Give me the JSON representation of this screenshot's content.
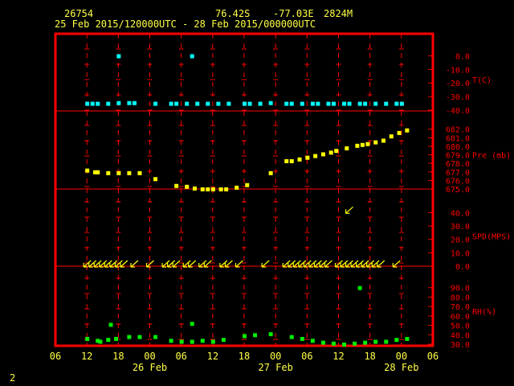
{
  "header": {
    "station_id": "26754",
    "lat": "76.42S",
    "lon": "-77.03E",
    "elevation": "2824M",
    "time_range": "25 Feb 2015/120000UTC - 28 Feb 2015/000000UTC"
  },
  "page_number": "2",
  "colors": {
    "frame": "#ff0000",
    "text": "#ffff44",
    "temperature": "#00ffff",
    "pressure": "#ffff00",
    "wind": "#ffff00",
    "rh": "#00ee00"
  },
  "chart_data": {
    "type": "scatter",
    "x_axis": {
      "unit": "hours since 26 Feb 00 UTC",
      "range": [
        -18,
        54
      ],
      "tick_values": [
        -18,
        -12,
        -6,
        0,
        6,
        12,
        18,
        24,
        30,
        36,
        42,
        48,
        54
      ],
      "tick_labels": [
        "06",
        "12",
        "18",
        "00",
        "06",
        "12",
        "18",
        "00",
        "06",
        "12",
        "18",
        "00",
        "06"
      ],
      "date_labels": [
        {
          "x": 0,
          "label": "26 Feb"
        },
        {
          "x": 24,
          "label": "27 Feb"
        },
        {
          "x": 48,
          "label": "28 Feb"
        }
      ]
    },
    "panels": [
      {
        "name": "temperature",
        "label": "T(C)",
        "ylim": [
          -40,
          5
        ],
        "tick_values": [
          0,
          -10,
          -20,
          -30,
          -40
        ],
        "tick_labels": [
          "0.0",
          "-10.0",
          "-20.0",
          "-30.0",
          "-40.0"
        ],
        "points": [
          [
            -12,
            -35
          ],
          [
            -11,
            -35
          ],
          [
            -10,
            -35
          ],
          [
            -8,
            -35
          ],
          [
            -6,
            -34.5
          ],
          [
            -4,
            -34.5
          ],
          [
            -3,
            -34.5
          ],
          [
            1,
            -35
          ],
          [
            4,
            -35
          ],
          [
            5,
            -35
          ],
          [
            7,
            -35
          ],
          [
            9,
            -35
          ],
          [
            11,
            -35
          ],
          [
            13,
            -35
          ],
          [
            15,
            -35
          ],
          [
            18,
            -35
          ],
          [
            19,
            -35
          ],
          [
            21,
            -35
          ],
          [
            23,
            -34.5
          ],
          [
            26,
            -35
          ],
          [
            27,
            -35
          ],
          [
            29,
            -35
          ],
          [
            31,
            -35
          ],
          [
            32,
            -35
          ],
          [
            34,
            -35
          ],
          [
            35,
            -35
          ],
          [
            37,
            -35
          ],
          [
            38,
            -35
          ],
          [
            40,
            -35
          ],
          [
            41,
            -35
          ],
          [
            43,
            -35
          ],
          [
            45,
            -35
          ],
          [
            47,
            -35
          ],
          [
            48,
            -35
          ],
          [
            -6,
            0
          ],
          [
            8,
            0
          ]
        ]
      },
      {
        "name": "pressure",
        "label": "Pre (mb)",
        "ylim": [
          675,
          683
        ],
        "tick_values": [
          682,
          681,
          680,
          679,
          678,
          677,
          676,
          675
        ],
        "tick_labels": [
          "682.0",
          "681.0",
          "680.0",
          "679.0",
          "678.0",
          "677.0",
          "676.0",
          "675.0"
        ],
        "points": [
          [
            -12,
            677.2
          ],
          [
            -10.5,
            677
          ],
          [
            -10,
            677
          ],
          [
            -8,
            676.9
          ],
          [
            -6,
            676.9
          ],
          [
            -4,
            676.9
          ],
          [
            -2,
            676.9
          ],
          [
            1,
            676.2
          ],
          [
            5,
            675.4
          ],
          [
            7,
            675.3
          ],
          [
            8.5,
            675.1
          ],
          [
            10,
            675
          ],
          [
            11,
            675
          ],
          [
            12,
            675
          ],
          [
            13.5,
            675
          ],
          [
            14.5,
            675
          ],
          [
            16.5,
            675.2
          ],
          [
            18.5,
            675.5
          ],
          [
            23,
            676.9
          ],
          [
            26,
            678.3
          ],
          [
            27,
            678.3
          ],
          [
            28.5,
            678.5
          ],
          [
            30,
            678.7
          ],
          [
            31.5,
            678.9
          ],
          [
            33,
            679.1
          ],
          [
            34.5,
            679.3
          ],
          [
            35.5,
            679.5
          ],
          [
            37.5,
            679.8
          ],
          [
            39.5,
            680.1
          ],
          [
            40.5,
            680.2
          ],
          [
            41.5,
            680.3
          ],
          [
            43,
            680.5
          ],
          [
            44.5,
            680.7
          ],
          [
            46,
            681.2
          ],
          [
            47.5,
            681.6
          ],
          [
            49,
            681.9
          ]
        ]
      },
      {
        "name": "wind",
        "label": "SPD(MPS)",
        "ylim": [
          0,
          45
        ],
        "tick_values": [
          40,
          30,
          20,
          10,
          0
        ],
        "tick_labels": [
          "40.0",
          "30.0",
          "20.0",
          "10.0",
          "0.0"
        ],
        "points": [
          [
            -12,
            0
          ],
          [
            -11,
            0
          ],
          [
            -10,
            0
          ],
          [
            -9,
            0
          ],
          [
            -8,
            0
          ],
          [
            -7,
            0
          ],
          [
            -6,
            0
          ],
          [
            -5,
            0
          ],
          [
            -3,
            0
          ],
          [
            0,
            0
          ],
          [
            3,
            0
          ],
          [
            4,
            0
          ],
          [
            5,
            0
          ],
          [
            7,
            0
          ],
          [
            8,
            0
          ],
          [
            10,
            0
          ],
          [
            11,
            0
          ],
          [
            14,
            0
          ],
          [
            15,
            0
          ],
          [
            17,
            0
          ],
          [
            22,
            0
          ],
          [
            26,
            0
          ],
          [
            27,
            0
          ],
          [
            28,
            0
          ],
          [
            29,
            0
          ],
          [
            30,
            0
          ],
          [
            31,
            0
          ],
          [
            32,
            0
          ],
          [
            33,
            0
          ],
          [
            34,
            0
          ],
          [
            36,
            0
          ],
          [
            37,
            0
          ],
          [
            38,
            0
          ],
          [
            39,
            0
          ],
          [
            40,
            0
          ],
          [
            41,
            0
          ],
          [
            42,
            0
          ],
          [
            43,
            0
          ],
          [
            44,
            0
          ],
          [
            47,
            0
          ],
          [
            38,
            40
          ]
        ]
      },
      {
        "name": "rh",
        "label": "RH(%)",
        "ylim": [
          30,
          100
        ],
        "tick_values": [
          90,
          80,
          70,
          60,
          50,
          40,
          30
        ],
        "tick_labels": [
          "90.0",
          "80.0",
          "70.0",
          "60.0",
          "50.0",
          "40.0",
          "30.0"
        ],
        "points": [
          [
            -12,
            36
          ],
          [
            -10,
            34
          ],
          [
            -9.5,
            33
          ],
          [
            -8,
            35
          ],
          [
            -6.5,
            36
          ],
          [
            -4,
            38
          ],
          [
            -2,
            38
          ],
          [
            1,
            38
          ],
          [
            4,
            34
          ],
          [
            6,
            33
          ],
          [
            8,
            33
          ],
          [
            10,
            34
          ],
          [
            12,
            33
          ],
          [
            14,
            35
          ],
          [
            18,
            39
          ],
          [
            20,
            40
          ],
          [
            23,
            41
          ],
          [
            27,
            38
          ],
          [
            29,
            36
          ],
          [
            31,
            34
          ],
          [
            33,
            32
          ],
          [
            35,
            31
          ],
          [
            37,
            30
          ],
          [
            39,
            31
          ],
          [
            41,
            32
          ],
          [
            43,
            33
          ],
          [
            45,
            33
          ],
          [
            47,
            35
          ],
          [
            49,
            36
          ],
          [
            -7.5,
            51
          ],
          [
            8,
            52
          ],
          [
            40,
            90
          ]
        ]
      }
    ]
  }
}
